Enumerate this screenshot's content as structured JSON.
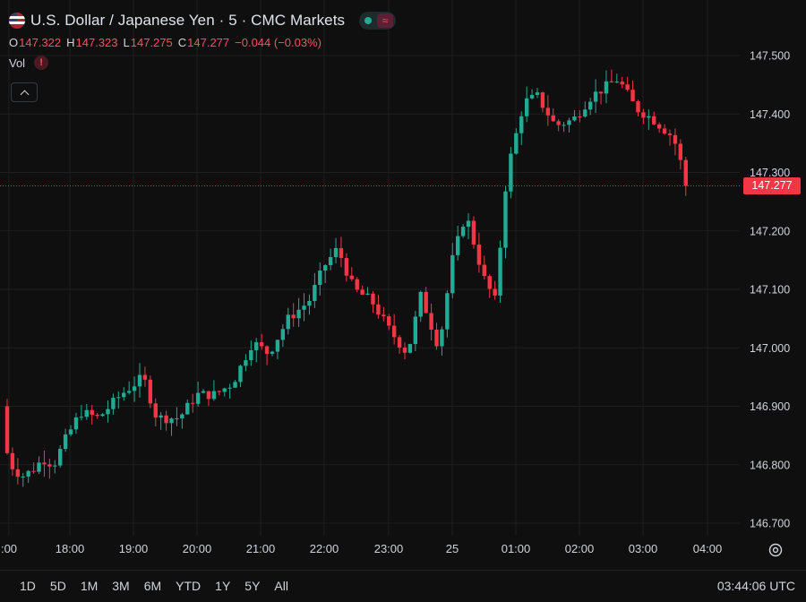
{
  "header": {
    "title": "U.S. Dollar / Japanese Yen · 5 · CMC Markets",
    "flag_icon": "us-flag-icon",
    "status_icon": "market-open-dot-icon",
    "wave_icon": "wave-icon",
    "ohlc": {
      "open_label": "O",
      "open": "147.322",
      "high_label": "H",
      "high": "147.323",
      "low_label": "L",
      "low": "147.275",
      "close_label": "C",
      "close": "147.277",
      "change": "−0.044 (−0.03%)"
    },
    "volume_label": "Vol",
    "alert_icon": "alert-icon",
    "collapse_icon": "chevron-up-icon"
  },
  "last_price": "147.277",
  "time_ranges": [
    "1D",
    "5D",
    "1M",
    "3M",
    "6M",
    "YTD",
    "1Y",
    "5Y",
    "All"
  ],
  "clock": "03:44:06 UTC",
  "settings_icon": "gear-icon",
  "colors": {
    "background": "#0f0f0f",
    "grid": "#1f1f1f",
    "up": "#22ab94",
    "down": "#f23645",
    "text": "#d1d4dc"
  },
  "chart_data": {
    "type": "candlestick",
    "y_ticks": [
      "147.500",
      "147.400",
      "147.300",
      "147.200",
      "147.100",
      "147.000",
      "146.900",
      "146.800",
      "146.700"
    ],
    "ylim": [
      146.68,
      147.52
    ],
    "x_ticks": [
      ":00",
      "18:00",
      "19:00",
      "20:00",
      "21:00",
      "22:00",
      "23:00",
      "25",
      "01:00",
      "02:00",
      "03:00",
      "04:00"
    ],
    "last_price": 147.277
  }
}
